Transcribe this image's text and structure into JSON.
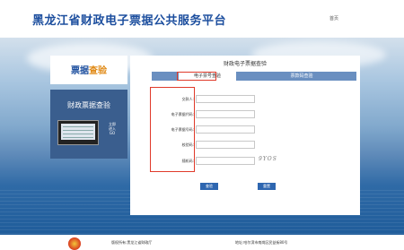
{
  "header": {
    "title": "黑龙江省财政电子票据公共服务平台",
    "home_link": "首页"
  },
  "left_panel": {
    "title_part1": "票据",
    "title_part2": "查验",
    "subtitle": "财政票据查验",
    "mini_text": "立即\n进入\nGO"
  },
  "main": {
    "card_title": "财政电子票据查验",
    "tabs": [
      {
        "label": "电子票号查验",
        "active": true
      },
      {
        "label": "票款码查验",
        "active": false
      }
    ],
    "fields": [
      {
        "label": "交款人:",
        "value": ""
      },
      {
        "label": "电子票据代码:",
        "value": ""
      },
      {
        "label": "电子票据号码:",
        "value": ""
      },
      {
        "label": "校验码:",
        "value": ""
      },
      {
        "label": "随机码:",
        "value": ""
      }
    ],
    "captcha_text": "9YOS",
    "query_button": "查验",
    "reset_button": "重置"
  },
  "footer": {
    "copyright": "版权所有:黑龙江省财政厅",
    "address": "地址:哈尔滨市南岗区民益街80号"
  },
  "colors": {
    "brand_blue": "#1c4e9e",
    "accent_orange": "#e08a17",
    "highlight_red": "#e03a2a",
    "button_blue": "#2e66b0"
  }
}
